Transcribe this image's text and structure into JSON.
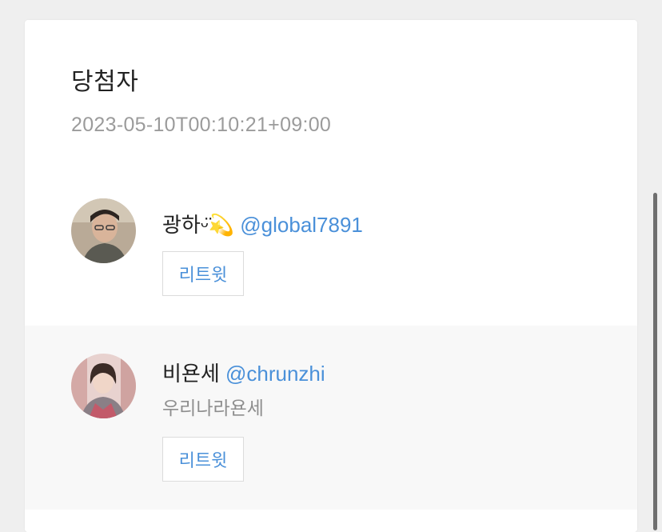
{
  "header": {
    "title": "당첨자",
    "timestamp": "2023-05-10T00:10:21+09:00"
  },
  "winners": [
    {
      "name": "광하ᵕ̈💫",
      "handle": "@global7891",
      "bio": "",
      "retweet_label": "리트윗"
    },
    {
      "name": "비욘세",
      "handle": "@chrunzhi",
      "bio": "우리나라욘세",
      "retweet_label": "리트윗"
    }
  ],
  "colors": {
    "accent": "#4a90d9",
    "background": "#efefef",
    "card": "#ffffff",
    "alt_row": "#f8f8f8"
  }
}
